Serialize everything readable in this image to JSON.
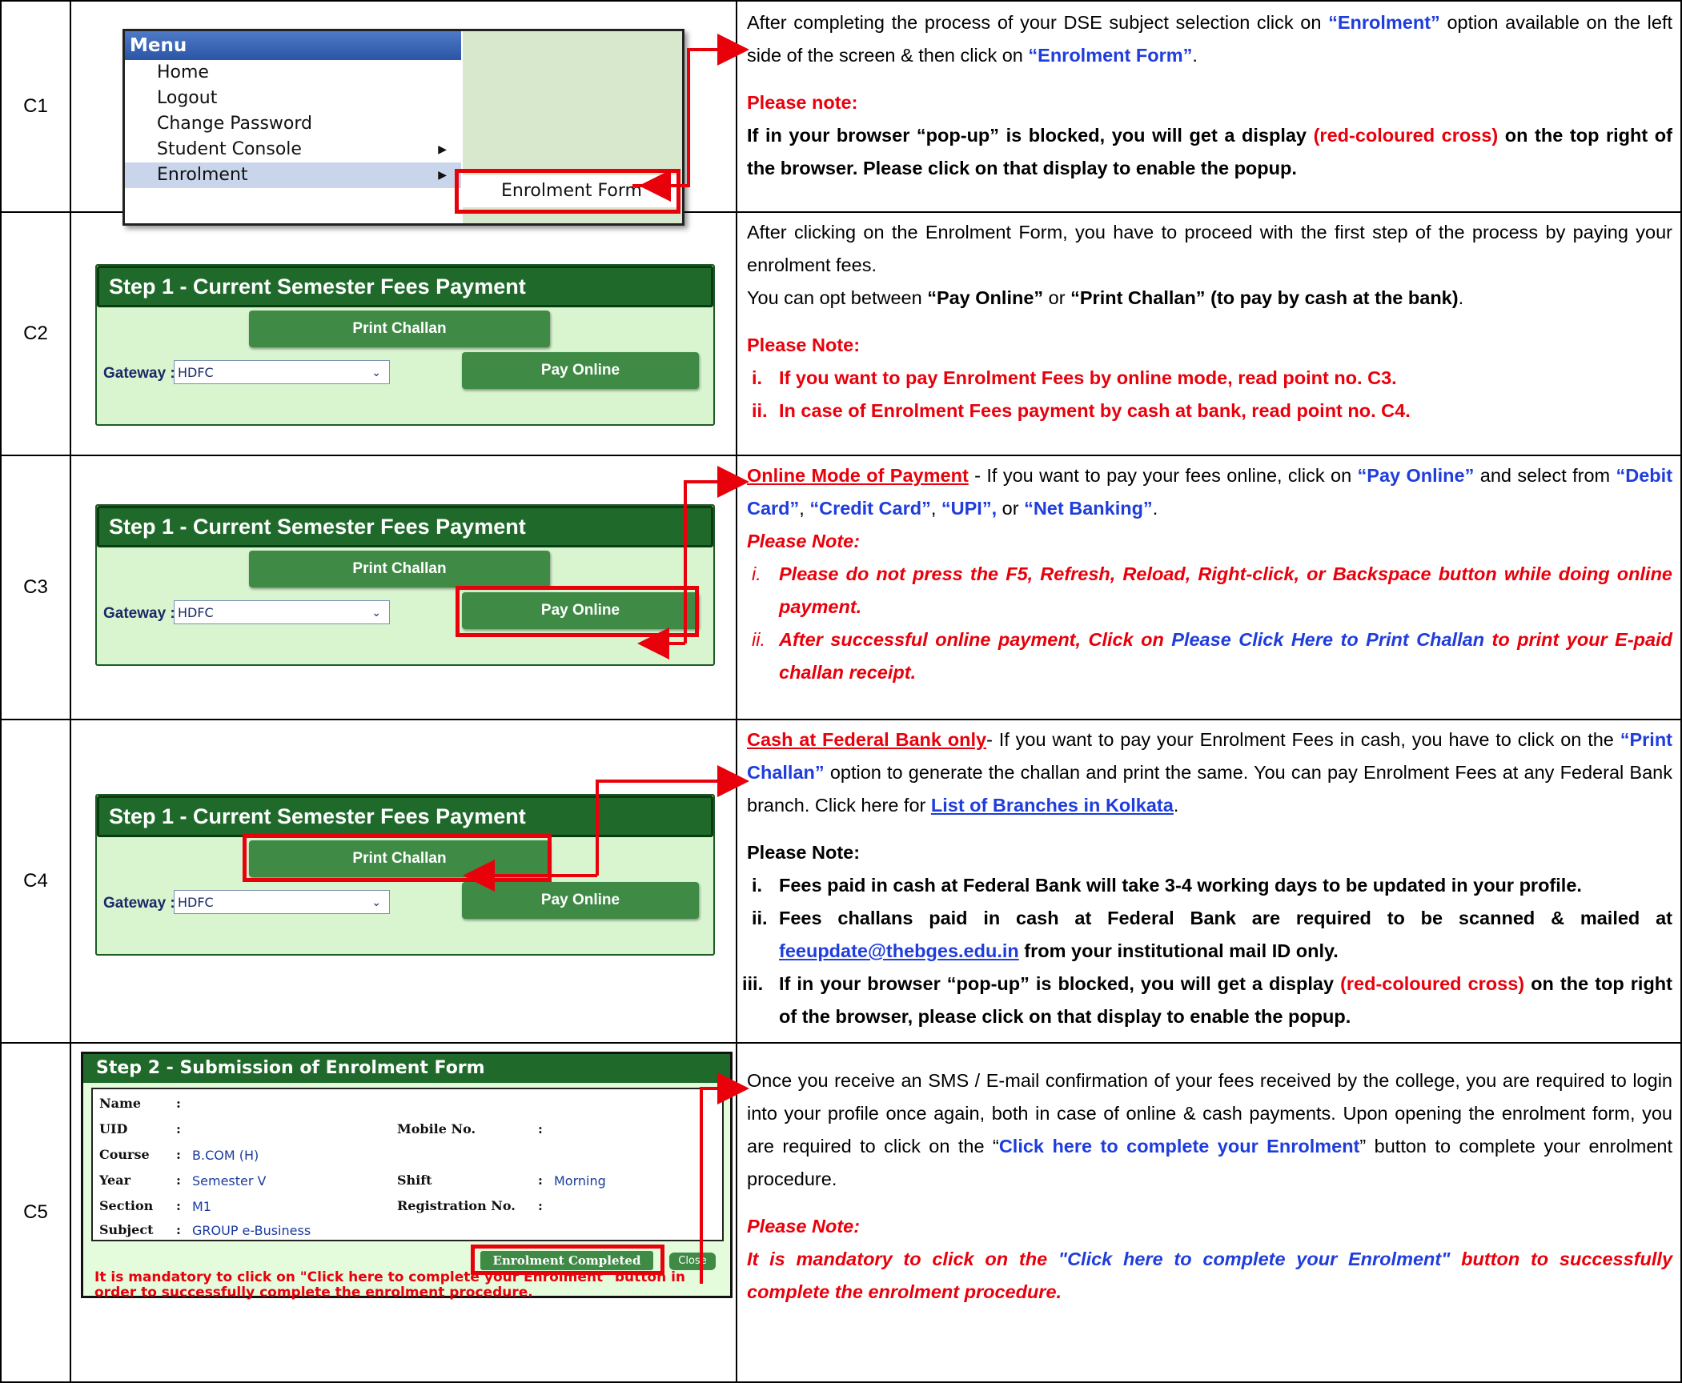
{
  "rows": [
    {
      "code": "C1",
      "menu": {
        "title": "Menu",
        "items": [
          "Home",
          "Logout",
          "Change Password",
          "Student Console",
          "Enrolment"
        ],
        "submenu": "Enrolment Form"
      },
      "text": {
        "p1a": "After completing the process of your DSE subject selection click on ",
        "p1b": "“Enrolment”",
        "p1c": " option available on the left side of the screen & then click on ",
        "p1d": "“Enrolment Form”",
        "p1e": ".",
        "note_title": "Please note:",
        "note_a": "If in your browser “pop-up” is blocked, you will get a display ",
        "note_b": "(red-coloured cross)",
        "note_c": " on the top right of the browser. Please click on that display to enable the popup."
      }
    },
    {
      "code": "C2",
      "step": {
        "title": "Step 1 - Current Semester Fees Payment",
        "print": "Print Challan",
        "gateway_label": "Gateway :",
        "gateway_value": "HDFC",
        "pay": "Pay Online"
      },
      "text": {
        "p1": "After clicking on the Enrolment Form, you have to proceed with the first step of the process by paying your enrolment fees.",
        "p2a": "You can opt between ",
        "p2b": "“Pay Online”",
        "p2c": " or ",
        "p2d": "“Print Challan” (to pay by cash at the bank)",
        "p2e": ".",
        "note_title": "Please Note:",
        "li1_num": "i.",
        "li1": "If you want to pay Enrolment Fees by online mode, read point no. C3.",
        "li2_num": "ii.",
        "li2": "In case of Enrolment Fees payment by cash at bank, read point no. C4."
      }
    },
    {
      "code": "C3",
      "step": {
        "title": "Step 1 - Current Semester Fees Payment",
        "print": "Print Challan",
        "gateway_label": "Gateway :",
        "gateway_value": "HDFC",
        "pay": "Pay Online"
      },
      "text": {
        "link": "Online Mode of Payment",
        "p1a": " - If you want to pay your fees online, click on ",
        "p1b": "“Pay Online”",
        "p1c": " and select from ",
        "p1d": "“Debit Card”",
        "p1e": ", ",
        "p1f": "“Credit Card”",
        "p1g": ", ",
        "p1h": "“UPI”,",
        "p1i": " or ",
        "p1j": "“Net Banking”",
        "p1k": ".",
        "note_title": "Please Note:",
        "li1_num": "i.",
        "li1": "Please do not press the F5, Refresh, Reload, Right-click, or Backspace button while doing online payment.",
        "li2_num": "ii.",
        "li2a": "After successful online payment, Click on ",
        "li2b": "Please Click Here to Print Challan",
        "li2c": " to print your E-paid challan receipt."
      }
    },
    {
      "code": "C4",
      "step": {
        "title": "Step 1 - Current Semester Fees Payment",
        "print": "Print Challan",
        "gateway_label": "Gateway :",
        "gateway_value": "HDFC",
        "pay": "Pay Online"
      },
      "text": {
        "link": "Cash at Federal Bank only",
        "p1a": "- If you want to pay your Enrolment Fees in cash, you have to click on the ",
        "p1b": "“Print Challan”",
        "p1c": " option to generate the challan and print the same. You can pay Enrolment Fees at any Federal Bank branch. Click here for ",
        "p1d": "List of Branches in Kolkata",
        "p1e": ".",
        "note_title": "Please Note:",
        "li1_num": "i.",
        "li1": "Fees paid in cash at Federal Bank will take 3-4 working days to be updated in your profile.",
        "li2_num": "ii.",
        "li2a": "Fees challans paid in cash at Federal Bank are required to be scanned & mailed at ",
        "li2b": "feeupdate@thebges.edu.in",
        "li2c": " from your institutional mail ID only.",
        "li3_num": "iii.",
        "li3a": "If in your browser “pop-up” is blocked, you will get a display ",
        "li3b": "(red-coloured cross)",
        "li3c": " on the top right of the browser, please click on that display to enable the popup."
      }
    },
    {
      "code": "C5",
      "step2": {
        "title": "Step 2 - Submission of Enrolment Form",
        "name_label": "Name",
        "uid_label": "UID",
        "mobile_label": "Mobile No.",
        "course_label": "Course",
        "course_value": "B.COM (H)",
        "year_label": "Year",
        "year_value": "Semester V",
        "shift_label": "Shift",
        "shift_value": "Morning",
        "section_label": "Section",
        "section_value": "M1",
        "reg_label": "Registration No.",
        "subject_label": "Subject",
        "subject_value": "GROUP e-Business",
        "colon": ":",
        "enrol_button": "Enrolment Completed",
        "close_button": "Close",
        "warning": "It is mandatory to click on \"Click here to complete your Enrolment\" button in order to successfully complete the enrolment procedure."
      },
      "text": {
        "p1a": "Once you receive an SMS / E-mail confirmation of your fees received by the college, you are required to login into your profile once again, both in case of online & cash payments. Upon opening the enrolment form, you are required to click on the “",
        "p1b": "Click here to complete your Enrolment",
        "p1c": "” button to complete your enrolment procedure.",
        "note_title": "Please Note:",
        "n1": "It is mandatory to click on the ",
        "n2": "\"Click here to complete your Enrolment\"",
        "n3": " button to successfully complete the enrolment procedure."
      }
    }
  ],
  "colors": {
    "red": "#e8000b",
    "blue": "#1f3ddc",
    "green_header": "#1f6a2a",
    "green_button": "#3f8a45"
  }
}
